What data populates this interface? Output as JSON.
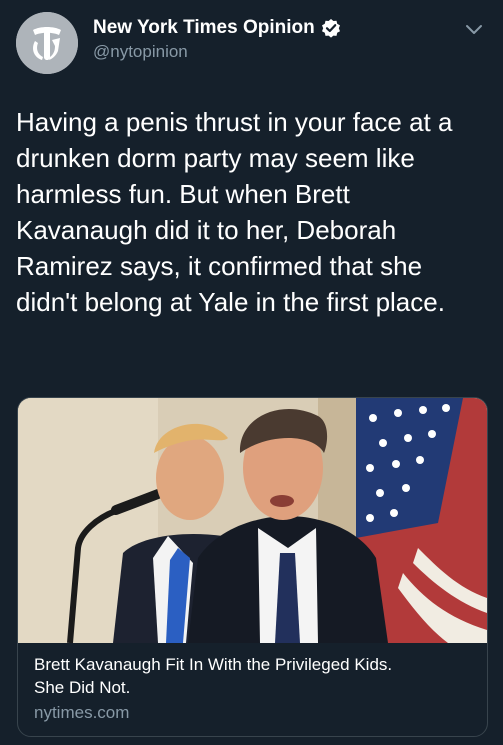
{
  "account": {
    "display_name": "New York Times Opinion",
    "handle": "@nytopinion",
    "verified": true,
    "avatar_icon": "nyt-t-logo-icon"
  },
  "tweet": {
    "text": "Having a penis thrust in your face at a\ndrunken dorm party may seem like\nharmless fun. But when Brett\nKavanaugh did it to her, Deborah\nRamirez says, it confirmed that she\ndidn't belong at Yale in the first place."
  },
  "link_card": {
    "title": "Brett Kavanaugh Fit In With the Privileged Kids.\nShe Did Not.",
    "domain": "nytimes.com",
    "image_icon": "article-photo"
  },
  "colors": {
    "background": "#15202b",
    "text": "#ffffff",
    "secondary_text": "#8899a6",
    "border": "#38444d",
    "verified_badge": "#ffffff"
  }
}
